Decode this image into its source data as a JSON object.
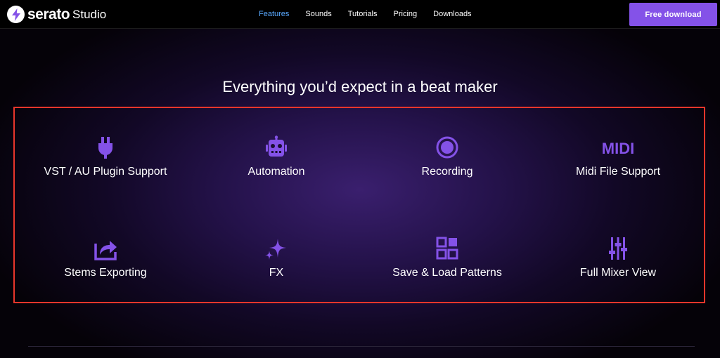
{
  "header": {
    "brand": "serato",
    "product": "Studio",
    "nav": [
      {
        "label": "Features",
        "active": true
      },
      {
        "label": "Sounds",
        "active": false
      },
      {
        "label": "Tutorials",
        "active": false
      },
      {
        "label": "Pricing",
        "active": false
      },
      {
        "label": "Downloads",
        "active": false
      }
    ],
    "cta_label": "Free download"
  },
  "main": {
    "headline": "Everything you’d expect in a beat maker",
    "features": [
      {
        "label": "VST / AU Plugin Support",
        "icon": "plug-icon"
      },
      {
        "label": "Automation",
        "icon": "robot-icon"
      },
      {
        "label": "Recording",
        "icon": "record-icon"
      },
      {
        "label": "Midi File Support",
        "icon": "midi-icon",
        "icon_text": "MIDI"
      },
      {
        "label": "Stems Exporting",
        "icon": "export-icon"
      },
      {
        "label": "FX",
        "icon": "sparkle-icon"
      },
      {
        "label": "Save & Load Patterns",
        "icon": "grid-icon"
      },
      {
        "label": "Full Mixer View",
        "icon": "mixer-sliders-icon"
      }
    ]
  },
  "colors": {
    "accent": "#8452e8",
    "icon": "#8452e8",
    "nav_active": "#59a9ff",
    "highlight_border": "#e8362b"
  }
}
